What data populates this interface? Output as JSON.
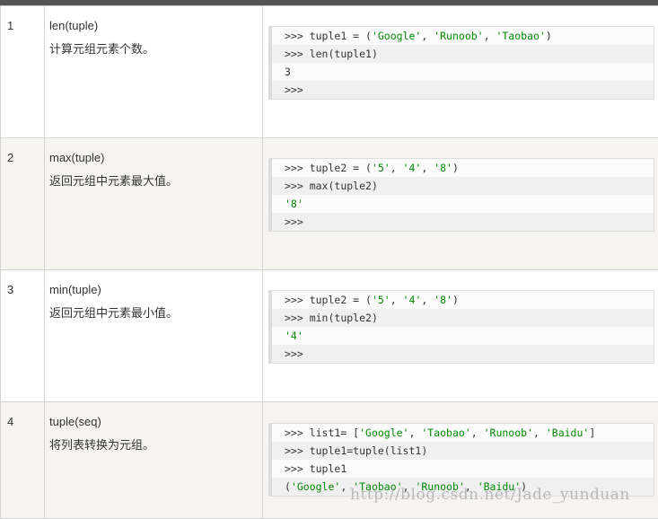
{
  "rows": [
    {
      "num": "1",
      "func": "len(tuple)",
      "desc": "计算元组元素个数。",
      "code": [
        {
          "prompt": ">>> ",
          "parts": [
            {
              "t": "tuple1 = (",
              "s": false
            },
            {
              "t": "'Google'",
              "s": true
            },
            {
              "t": ", ",
              "s": false
            },
            {
              "t": "'Runoob'",
              "s": true
            },
            {
              "t": ", ",
              "s": false
            },
            {
              "t": "'Taobao'",
              "s": true
            },
            {
              "t": ")",
              "s": false
            }
          ]
        },
        {
          "prompt": ">>> ",
          "parts": [
            {
              "t": "len(tuple1)",
              "s": false
            }
          ]
        },
        {
          "prompt": "",
          "parts": [
            {
              "t": "3",
              "s": false
            }
          ]
        },
        {
          "prompt": ">>>",
          "parts": []
        }
      ]
    },
    {
      "num": "2",
      "func": "max(tuple)",
      "desc": "返回元组中元素最大值。",
      "code": [
        {
          "prompt": ">>> ",
          "parts": [
            {
              "t": "tuple2 = (",
              "s": false
            },
            {
              "t": "'5'",
              "s": true
            },
            {
              "t": ", ",
              "s": false
            },
            {
              "t": "'4'",
              "s": true
            },
            {
              "t": ", ",
              "s": false
            },
            {
              "t": "'8'",
              "s": true
            },
            {
              "t": ")",
              "s": false
            }
          ]
        },
        {
          "prompt": ">>> ",
          "parts": [
            {
              "t": "max(tuple2)",
              "s": false
            }
          ]
        },
        {
          "prompt": "",
          "parts": [
            {
              "t": "'8'",
              "s": true
            }
          ]
        },
        {
          "prompt": ">>>",
          "parts": []
        }
      ]
    },
    {
      "num": "3",
      "func": "min(tuple)",
      "desc": "返回元组中元素最小值。",
      "code": [
        {
          "prompt": ">>> ",
          "parts": [
            {
              "t": "tuple2 = (",
              "s": false
            },
            {
              "t": "'5'",
              "s": true
            },
            {
              "t": ", ",
              "s": false
            },
            {
              "t": "'4'",
              "s": true
            },
            {
              "t": ", ",
              "s": false
            },
            {
              "t": "'8'",
              "s": true
            },
            {
              "t": ")",
              "s": false
            }
          ]
        },
        {
          "prompt": ">>> ",
          "parts": [
            {
              "t": "min(tuple2)",
              "s": false
            }
          ]
        },
        {
          "prompt": "",
          "parts": [
            {
              "t": "'4'",
              "s": true
            }
          ]
        },
        {
          "prompt": ">>>",
          "parts": []
        }
      ]
    },
    {
      "num": "4",
      "func": "tuple(seq)",
      "desc": "将列表转换为元组。",
      "code": [
        {
          "prompt": ">>> ",
          "parts": [
            {
              "t": "list1= [",
              "s": false
            },
            {
              "t": "'Google'",
              "s": true
            },
            {
              "t": ", ",
              "s": false
            },
            {
              "t": "'Taobao'",
              "s": true
            },
            {
              "t": ", ",
              "s": false
            },
            {
              "t": "'Runoob'",
              "s": true
            },
            {
              "t": ", ",
              "s": false
            },
            {
              "t": "'Baidu'",
              "s": true
            },
            {
              "t": "]",
              "s": false
            }
          ]
        },
        {
          "prompt": ">>> ",
          "parts": [
            {
              "t": "tuple1=tuple(list1)",
              "s": false
            }
          ]
        },
        {
          "prompt": ">>> ",
          "parts": [
            {
              "t": "tuple1",
              "s": false
            }
          ]
        },
        {
          "prompt": "",
          "parts": [
            {
              "t": "(",
              "s": false
            },
            {
              "t": "'Google'",
              "s": true
            },
            {
              "t": ", ",
              "s": false
            },
            {
              "t": "'Taobao'",
              "s": true
            },
            {
              "t": ", ",
              "s": false
            },
            {
              "t": "'Runoob'",
              "s": true
            },
            {
              "t": ", ",
              "s": false
            },
            {
              "t": "'Baidu'",
              "s": true
            },
            {
              "t": ")",
              "s": false
            }
          ]
        }
      ]
    }
  ],
  "watermark": "http://blog.csdn.net/Jade_yunduan",
  "colors": {
    "string": "#008800",
    "alt_row": "#f6f4f0",
    "top_bar": "#555555"
  }
}
